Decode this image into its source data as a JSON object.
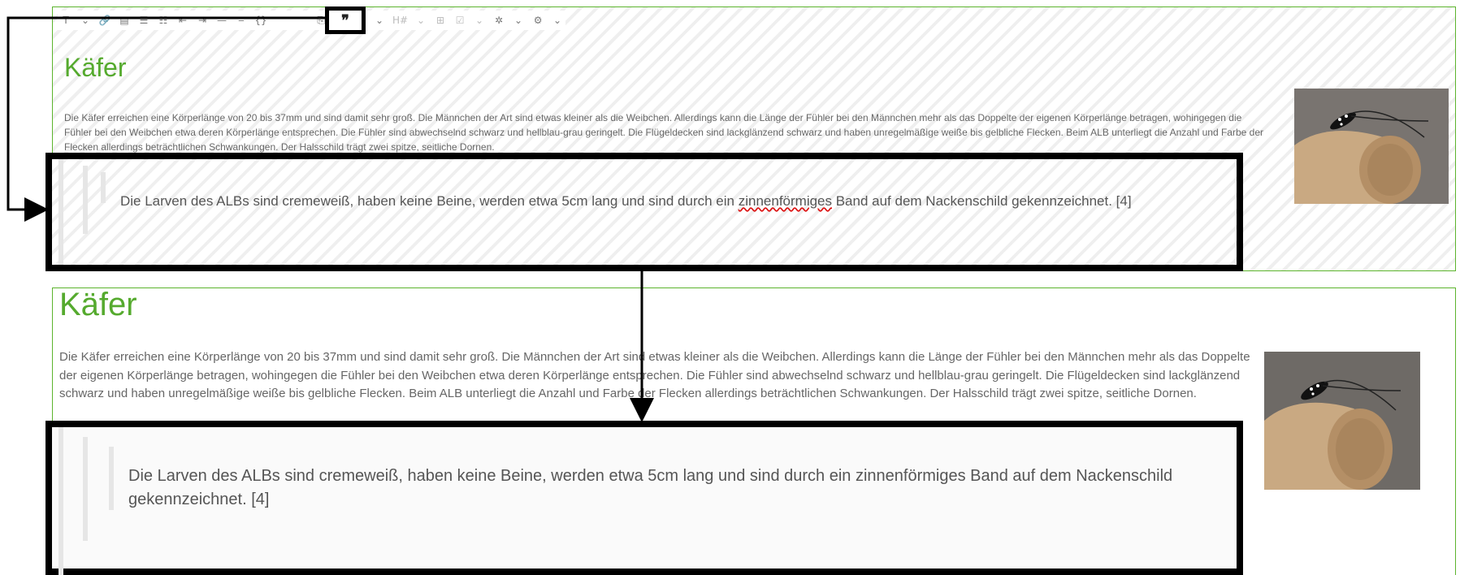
{
  "toolbar": {
    "items": [
      {
        "glyph": "T",
        "icon": "text-style-icon"
      },
      {
        "glyph": "⌄",
        "icon": "chevron-down-icon"
      },
      {
        "glyph": "🔗",
        "icon": "link-icon"
      },
      {
        "glyph": "▤",
        "icon": "document-icon"
      },
      {
        "glyph": "☰",
        "icon": "list-icon"
      },
      {
        "glyph": "☷",
        "icon": "numbered-list-icon"
      },
      {
        "glyph": "⇤",
        "icon": "outdent-icon"
      },
      {
        "glyph": "⇥",
        "icon": "indent-icon"
      },
      {
        "glyph": "—",
        "icon": "horizontal-rule-icon"
      },
      {
        "glyph": "‒",
        "icon": "minus-icon"
      },
      {
        "glyph": "{}",
        "icon": "code-icon"
      }
    ],
    "after_items": [
      {
        "glyph": "⎘",
        "icon": "copy-icon"
      },
      {
        "glyph": "◝",
        "icon": "rss-icon"
      },
      {
        "glyph": "☺",
        "icon": "emoji-icon"
      },
      {
        "glyph": "⌄",
        "icon": "chevron-down-icon"
      },
      {
        "glyph": "H#",
        "icon": "heading-anchor-icon"
      },
      {
        "glyph": "⌄",
        "icon": "chevron-down-icon"
      },
      {
        "glyph": "⊞",
        "icon": "table-icon"
      },
      {
        "glyph": "☑",
        "icon": "checklist-icon"
      },
      {
        "glyph": "⌄",
        "icon": "chevron-down-icon"
      },
      {
        "glyph": "✲",
        "icon": "puzzle-icon"
      },
      {
        "glyph": "⌄",
        "icon": "chevron-down-icon"
      },
      {
        "glyph": "⚙",
        "icon": "gear-icon"
      },
      {
        "glyph": "⌄",
        "icon": "chevron-down-icon"
      }
    ],
    "blockquote_glyph": "❞"
  },
  "editor": {
    "title": "Käfer",
    "paragraph": "Die Käfer erreichen eine Körperlänge von 20 bis 37mm und sind damit sehr groß. Die Männchen der Art sind etwas kleiner als die Weibchen. Allerdings kann die Länge der Fühler bei den Männchen mehr als das Doppelte der eigenen Körperlänge betragen, wohingegen die Fühler bei den Weibchen etwa deren Körperlänge entsprechen. Die Fühler sind abwechselnd schwarz und hellblau-grau geringelt. Die Flügeldecken sind lackglänzend schwarz und haben unregelmäßige weiße bis gelbliche Flecken. Beim ALB unterliegt die Anzahl und Farbe der Flecken allerdings beträchtlichen Schwankungen. Der Halsschild trägt zwei spitze, seitliche Dornen.",
    "quote_before": "Die Larven des ALBs sind cremeweiß, haben keine Beine, werden etwa 5cm lang und sind durch ein ",
    "quote_misspelled": "zinnenförmiges",
    "quote_after": " Band auf dem Nackenschild gekennzeichnet. [4]"
  },
  "preview": {
    "title": "Käfer",
    "paragraph": "Die Käfer erreichen eine Körperlänge von 20 bis 37mm und sind damit sehr groß. Die Männchen der Art sind etwas kleiner als die Weibchen. Allerdings kann die Länge der Fühler bei den Männchen mehr als das Doppelte der eigenen Körperlänge betragen, wohingegen die Fühler bei den Weibchen etwa deren Körperlänge entsprechen. Die Fühler sind abwechselnd schwarz und hellblau-grau geringelt. Die Flügeldecken sind lackglänzend schwarz und haben unregelmäßige weiße bis gelbliche Flecken. Beim ALB unterliegt die Anzahl und Farbe der Flecken allerdings beträchtlichen Schwankungen. Der Halsschild trägt zwei spitze, seitliche Dornen.",
    "quote": "Die Larven des ALBs sind cremeweiß, haben keine Beine, werden etwa 5cm lang und sind durch ein zinnenförmiges Band auf dem Nackenschild gekennzeichnet. [4]"
  },
  "colors": {
    "accent_green": "#55aa2e",
    "panel_border": "#5cb42d",
    "highlight": "#000000"
  }
}
